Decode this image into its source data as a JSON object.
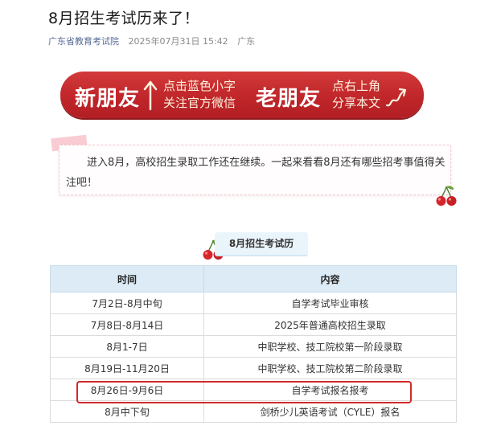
{
  "article": {
    "title": "8月招生考试历来了！",
    "account": "广东省教育考试院",
    "date": "2025年07月31日 15:42",
    "location": "广东"
  },
  "banner": {
    "new_friend": "新朋友",
    "new_line1": "点击蓝色小字",
    "new_line2": "关注官方微信",
    "old_friend": "老朋友",
    "old_line1": "点右上角",
    "old_line2": "分享本文"
  },
  "intro": {
    "text": "进入8月，高校招生录取工作还在继续。一起来看看8月还有哪些招考事值得关注吧！"
  },
  "calendar": {
    "label": "8月招生考试历",
    "headers": {
      "time": "时间",
      "content": "内容"
    },
    "rows": [
      {
        "time": "7月2日-8月中旬",
        "content": "自学考试毕业审核"
      },
      {
        "time": "7月8日-8月14日",
        "content": "2025年普通高校招生录取"
      },
      {
        "time": "8月1-7日",
        "content": "中职学校、技工院校第一阶段录取"
      },
      {
        "time": "8月19日-11月20日",
        "content": "中职学校、技工院校第二阶段录取"
      },
      {
        "time": "8月26日-9月6日",
        "content": "自学考试报名报考"
      },
      {
        "time": "8月中下旬",
        "content": "剑桥少儿英语考试（CYLE）报名"
      }
    ]
  },
  "colors": {
    "banner_red": "#c0262a",
    "header_blue": "#dcebf5",
    "highlight_red": "#d12a2a",
    "account_link": "#576b95"
  }
}
